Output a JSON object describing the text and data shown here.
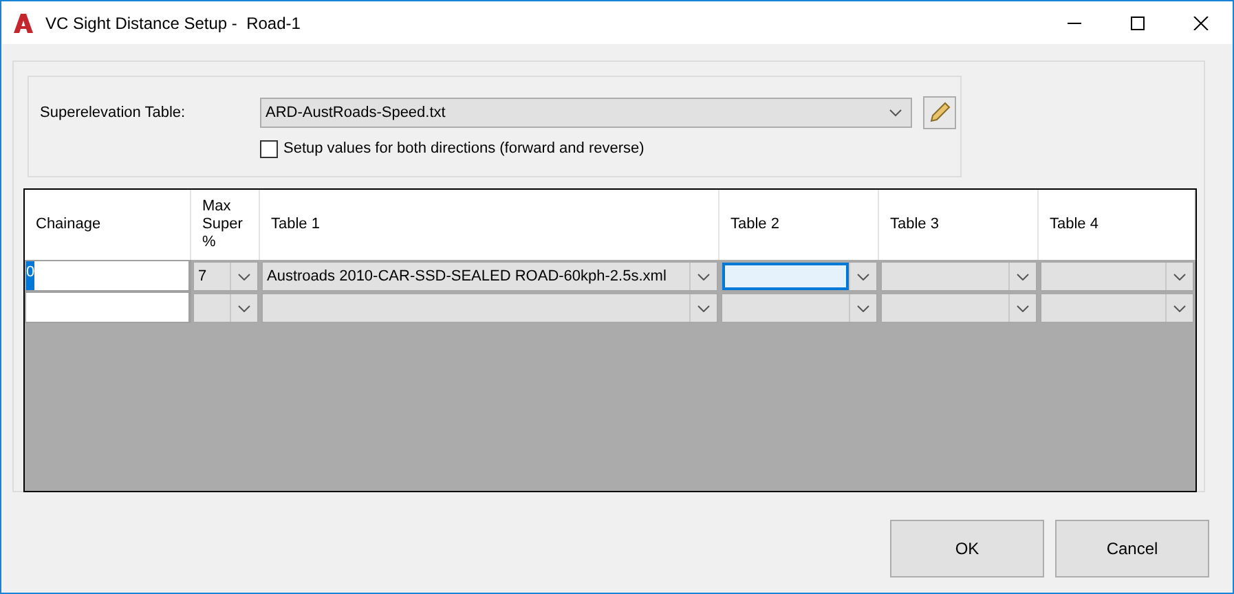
{
  "window": {
    "title": "VC Sight Distance Setup -  Road-1"
  },
  "superelevation": {
    "label": "Superelevation Table:",
    "value": "ARD-AustRoads-Speed.txt",
    "both_directions": {
      "label": "Setup values for both directions (forward and reverse)",
      "checked": false
    }
  },
  "grid": {
    "columns": [
      "Chainage",
      "Max\nSuper\n%",
      "Table 1",
      "Table 2",
      "Table 3",
      "Table 4"
    ],
    "rows": [
      {
        "cells": [
          {
            "kind": "text",
            "value": "0",
            "selected": true
          },
          {
            "kind": "combo",
            "value": "7",
            "focused": false
          },
          {
            "kind": "combo",
            "value": "Austroads 2010-CAR-SSD-SEALED ROAD-60kph-2.5s.xml",
            "focused": false
          },
          {
            "kind": "combo",
            "focused": true
          },
          {
            "kind": "combo",
            "focused": false
          },
          {
            "kind": "combo",
            "focused": false
          }
        ]
      },
      {
        "cells": [
          {
            "kind": "text"
          },
          {
            "kind": "combo",
            "focused": false
          },
          {
            "kind": "combo",
            "focused": false
          },
          {
            "kind": "combo",
            "focused": false
          },
          {
            "kind": "combo",
            "focused": false
          },
          {
            "kind": "combo",
            "focused": false
          }
        ]
      }
    ]
  },
  "buttons": [
    "OK",
    "Cancel"
  ]
}
